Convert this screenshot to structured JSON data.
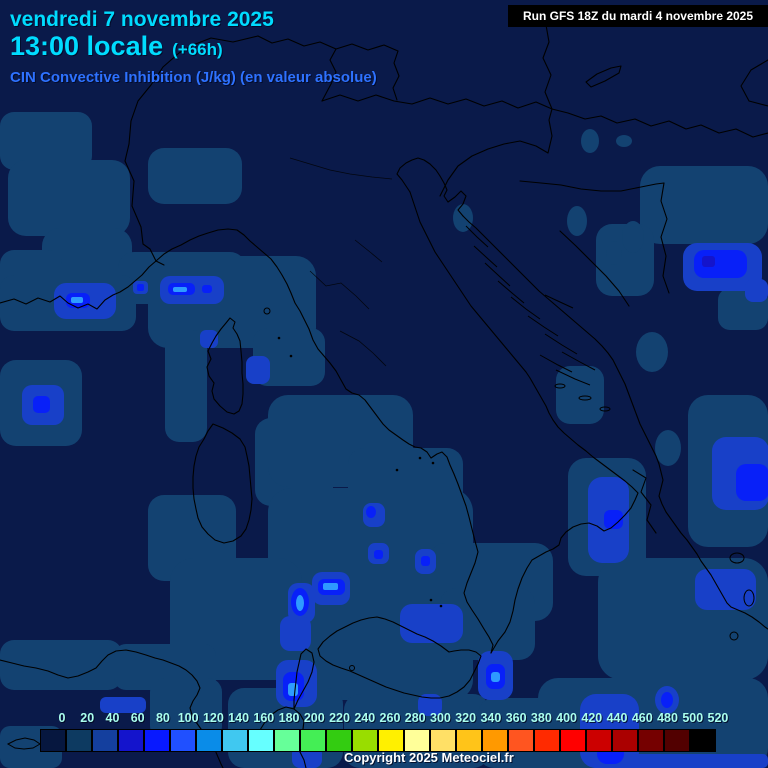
{
  "header": {
    "date": "vendredi 7 novembre 2025",
    "time": "13:00 locale",
    "offset": "(+66h)",
    "subtitle": "CIN Convective Inhibition (J/kg) (en valeur absolue)",
    "run": "Run GFS 18Z du mardi 4 novembre 2025"
  },
  "footer": {
    "copyright": "Copyright 2025 Meteociel.fr"
  },
  "colors": {
    "title_cyan": "#00dcff",
    "subtitle_blue": "#2e72ff",
    "map_background": "#0a1a4a",
    "coastline": "#000000",
    "runbar_background": "#000000",
    "runbar_text": "#ffffff",
    "scale_label": "#aaffee",
    "copyright_text": "#ffffff",
    "fill_level_20": "#134271",
    "fill_level_40": "#1840c8",
    "fill_level_60": "#1414cc",
    "fill_level_80": "#0820f8",
    "fill_level_bright_core": "#2e9bff"
  },
  "colorbar": {
    "tick_labels": [
      "0",
      "20",
      "40",
      "60",
      "80",
      "100",
      "120",
      "140",
      "160",
      "180",
      "200",
      "220",
      "240",
      "260",
      "280",
      "300",
      "320",
      "340",
      "360",
      "380",
      "400",
      "420",
      "440",
      "460",
      "480",
      "500",
      "520"
    ],
    "box_colors": [
      "#06173f",
      "#0d3a61",
      "#143f9e",
      "#1414cc",
      "#0819ff",
      "#2050ff",
      "#0a8ce8",
      "#40c8f0",
      "#66ffff",
      "#66ff99",
      "#44ee55",
      "#33cc11",
      "#99dd00",
      "#fff000",
      "#ffff99",
      "#ffe066",
      "#ffc419",
      "#ff9900",
      "#ff5520",
      "#ff2a00",
      "#ff0000",
      "#cc0000",
      "#aa0000",
      "#750000",
      "#520000",
      "#000000"
    ]
  },
  "chart_data": {
    "type": "heatmap",
    "title": "CIN Convective Inhibition (J/kg) (en valeur absolue)",
    "units": "J/kg",
    "legend_values": [
      0,
      20,
      40,
      60,
      80,
      100,
      120,
      140,
      160,
      180,
      200,
      220,
      240,
      260,
      280,
      300,
      320,
      340,
      360,
      380,
      400,
      420,
      440,
      460,
      480,
      500,
      520
    ],
    "legend_colors": [
      "#06173f",
      "#0d3a61",
      "#143f9e",
      "#1414cc",
      "#0819ff",
      "#2050ff",
      "#0a8ce8",
      "#40c8f0",
      "#66ffff",
      "#66ff99",
      "#44ee55",
      "#33cc11",
      "#99dd00",
      "#fff000",
      "#ffff99",
      "#ffe066",
      "#ffc419",
      "#ff9900",
      "#ff5520",
      "#ff2a00",
      "#ff0000",
      "#cc0000",
      "#aa0000",
      "#750000",
      "#520000",
      "#000000"
    ],
    "legend_position": "bottom",
    "value_range_shown": [
      0,
      120
    ]
  }
}
